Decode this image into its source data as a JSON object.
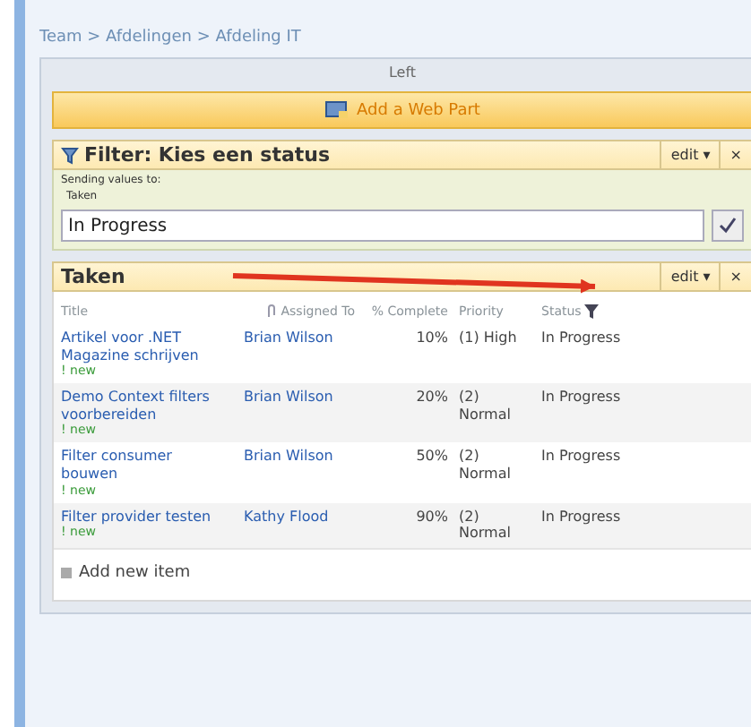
{
  "breadcrumb": "Team > Afdelingen > Afdeling IT",
  "zone_label": "Left",
  "add_web_part": "Add a Web Part",
  "filter_part": {
    "title": "Filter: Kies een status",
    "edit": "edit ▾",
    "close": "×",
    "sending_label": "Sending values to:",
    "target": "Taken",
    "value": "In Progress"
  },
  "list_part": {
    "title": "Taken",
    "edit": "edit ▾",
    "close": "×",
    "columns": [
      "Title",
      "Assigned To",
      "% Complete",
      "Priority",
      "Status"
    ],
    "rows": [
      {
        "title": "Artikel voor .NET Magazine schrijven",
        "badge": "! new",
        "assigned": "Brian Wilson",
        "complete": "10%",
        "priority": "(1) High",
        "status": "In Progress"
      },
      {
        "title": "Demo Context filters voorbereiden",
        "badge": "! new",
        "assigned": "Brian Wilson",
        "complete": "20%",
        "priority": "(2) Normal",
        "status": "In Progress"
      },
      {
        "title": "Filter consumer bouwen",
        "badge": "! new",
        "assigned": "Brian Wilson",
        "complete": "50%",
        "priority": "(2) Normal",
        "status": "In Progress"
      },
      {
        "title": "Filter provider testen",
        "badge": "! new",
        "assigned": "Kathy Flood",
        "complete": "90%",
        "priority": "(2) Normal",
        "status": "In Progress"
      }
    ],
    "add_item": "Add new item"
  }
}
